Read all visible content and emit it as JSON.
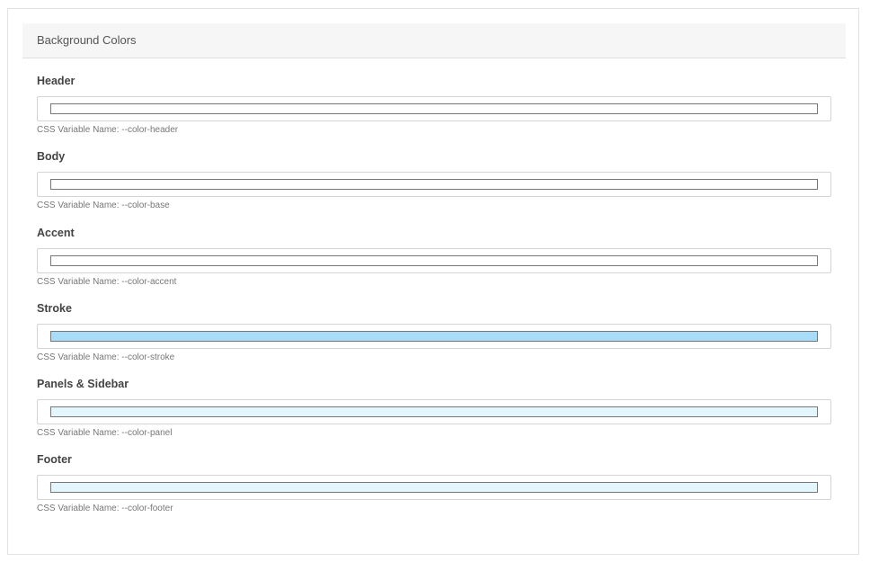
{
  "section": {
    "title": "Background Colors"
  },
  "fields": [
    {
      "label": "Header",
      "hint": "CSS Variable Name: --color-header",
      "color": "#ffffff"
    },
    {
      "label": "Body",
      "hint": "CSS Variable Name: --color-base",
      "color": "#ffffff"
    },
    {
      "label": "Accent",
      "hint": "CSS Variable Name: --color-accent",
      "color": "#ffffff"
    },
    {
      "label": "Stroke",
      "hint": "CSS Variable Name: --color-stroke",
      "color": "#a8dcf8"
    },
    {
      "label": "Panels & Sidebar",
      "hint": "CSS Variable Name: --color-panel",
      "color": "#e3f6fe"
    },
    {
      "label": "Footer",
      "hint": "CSS Variable Name: --color-footer",
      "color": "#e3f6fe"
    }
  ]
}
